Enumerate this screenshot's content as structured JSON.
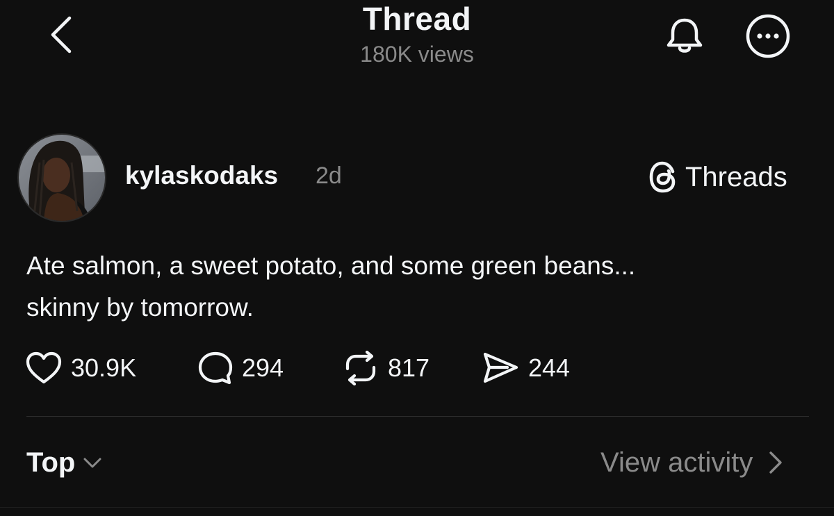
{
  "header": {
    "title": "Thread",
    "subtitle": "180K views",
    "back_icon": "chevron-left-icon",
    "bell_icon": "bell-icon",
    "more_icon": "more-horizontal-icon"
  },
  "post": {
    "username": "kylaskodaks",
    "timestamp": "2d",
    "source_label": "Threads",
    "source_icon": "threads-logo-icon",
    "text_line1": "Ate salmon, a sweet potato, and some green beans...",
    "text_line2": "skinny by tomorrow.",
    "actions": {
      "likes": "30.9K",
      "replies": "294",
      "reposts": "817",
      "shares": "244"
    }
  },
  "footer": {
    "sort_label": "Top",
    "view_activity_label": "View activity"
  },
  "colors": {
    "background": "#0f0f0f",
    "text_primary": "#f3f5f7",
    "text_secondary": "#8a8a8a",
    "divider": "#2e2e2e"
  }
}
